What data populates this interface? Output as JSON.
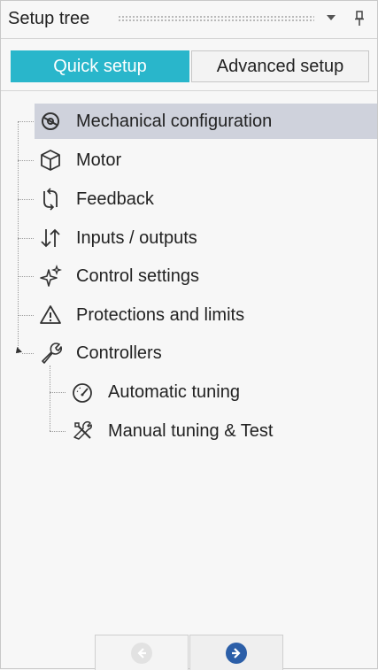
{
  "header": {
    "title": "Setup tree"
  },
  "tabs": [
    {
      "label": "Quick setup",
      "active": true
    },
    {
      "label": "Advanced setup",
      "active": false
    }
  ],
  "tree": {
    "items": [
      {
        "label": "Mechanical configuration",
        "icon": "gear-mechanics-icon",
        "selected": true
      },
      {
        "label": "Motor",
        "icon": "cube-icon"
      },
      {
        "label": "Feedback",
        "icon": "feedback-loop-icon"
      },
      {
        "label": "Inputs / outputs",
        "icon": "up-down-arrows-icon"
      },
      {
        "label": "Control settings",
        "icon": "sparkle-icon"
      },
      {
        "label": "Protections and limits",
        "icon": "warning-triangle-icon"
      },
      {
        "label": "Controllers",
        "icon": "wrench-icon",
        "expanded": true
      }
    ],
    "children": [
      {
        "label": "Automatic tuning",
        "icon": "gauge-icon"
      },
      {
        "label": "Manual tuning & Test",
        "icon": "tools-icon"
      }
    ]
  },
  "colors": {
    "accent": "#29b6cb",
    "selected_row": "#cfd2dc",
    "next_button": "#2c5fa8"
  }
}
